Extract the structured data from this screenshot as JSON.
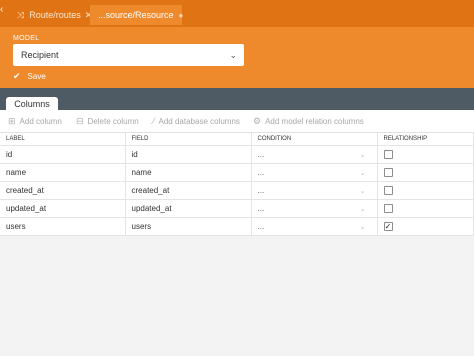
{
  "tabs": [
    {
      "label": "Route/routes",
      "icon": "shuffle-icon",
      "active": false
    },
    {
      "label": "...source/Resource",
      "icon": "document-icon",
      "active": true
    }
  ],
  "model": {
    "label": "MODEL",
    "value": "Recipient"
  },
  "save_label": "Save",
  "panel_tab": "Columns",
  "toolbar": {
    "add_column": "Add column",
    "delete_column": "Delete column",
    "add_database_columns": "Add database columns",
    "add_model_relation_columns": "Add model relation columns"
  },
  "table": {
    "headers": [
      "LABEL",
      "FIELD",
      "CONDITION",
      "RELATIONSHIP"
    ],
    "rows": [
      {
        "label": "id",
        "field": "id",
        "condition": "...",
        "relationship": false
      },
      {
        "label": "name",
        "field": "name",
        "condition": "...",
        "relationship": false
      },
      {
        "label": "created_at",
        "field": "created_at",
        "condition": "...",
        "relationship": false
      },
      {
        "label": "updated_at",
        "field": "updated_at",
        "condition": "...",
        "relationship": false
      },
      {
        "label": "users",
        "field": "users",
        "condition": "...",
        "relationship": true
      }
    ]
  },
  "colors": {
    "tabbar": "#e07415",
    "header": "#ef8a2c",
    "panel_bar": "#4f5b64"
  }
}
